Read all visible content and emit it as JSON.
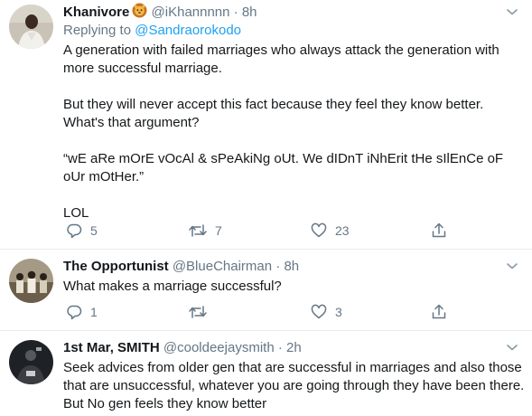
{
  "tweets": [
    {
      "author_name": "Khanivore",
      "author_emoji": "lion-face-emoji",
      "handle": "@iKhannnnn",
      "time": "· 8h",
      "replying_prefix": "Replying to ",
      "replying_to": "@Sandraorokodo",
      "paragraphs": [
        "A generation with failed marriages who always attack the generation with more successful marriage.",
        "But they will never accept this fact because they feel they know better. What's that argument?",
        "“wE aRe mOrE vOcAl & sPeAkiNg oUt. We dIDnT iNhErit tHe sIlEnCe oF oUr mOtHer.”",
        "LOL"
      ],
      "replies": "5",
      "retweets": "7",
      "likes": "23"
    },
    {
      "author_name": "The Opportunist",
      "handle": "@BlueChairman",
      "time": "· 8h",
      "paragraphs": [
        "What makes a marriage successful?"
      ],
      "replies": "1",
      "retweets": "",
      "likes": "3"
    },
    {
      "author_name": "1st Mar, SMITH",
      "handle": "@cooldeejaysmith",
      "time": "· 2h",
      "paragraphs": [
        "Seek advices from older gen that are successful in marriages and also those that are unsuccessful, whatever you are going through they have been there. But No gen feels they know better"
      ]
    }
  ],
  "icons": {
    "reply": "reply-icon",
    "retweet": "retweet-icon",
    "like": "heart-icon",
    "share": "share-icon",
    "more": "chevron-down-icon"
  },
  "colors": {
    "text": "#14171a",
    "secondary": "#657786",
    "link": "#1da1f2",
    "divider": "#e6ecf0"
  }
}
